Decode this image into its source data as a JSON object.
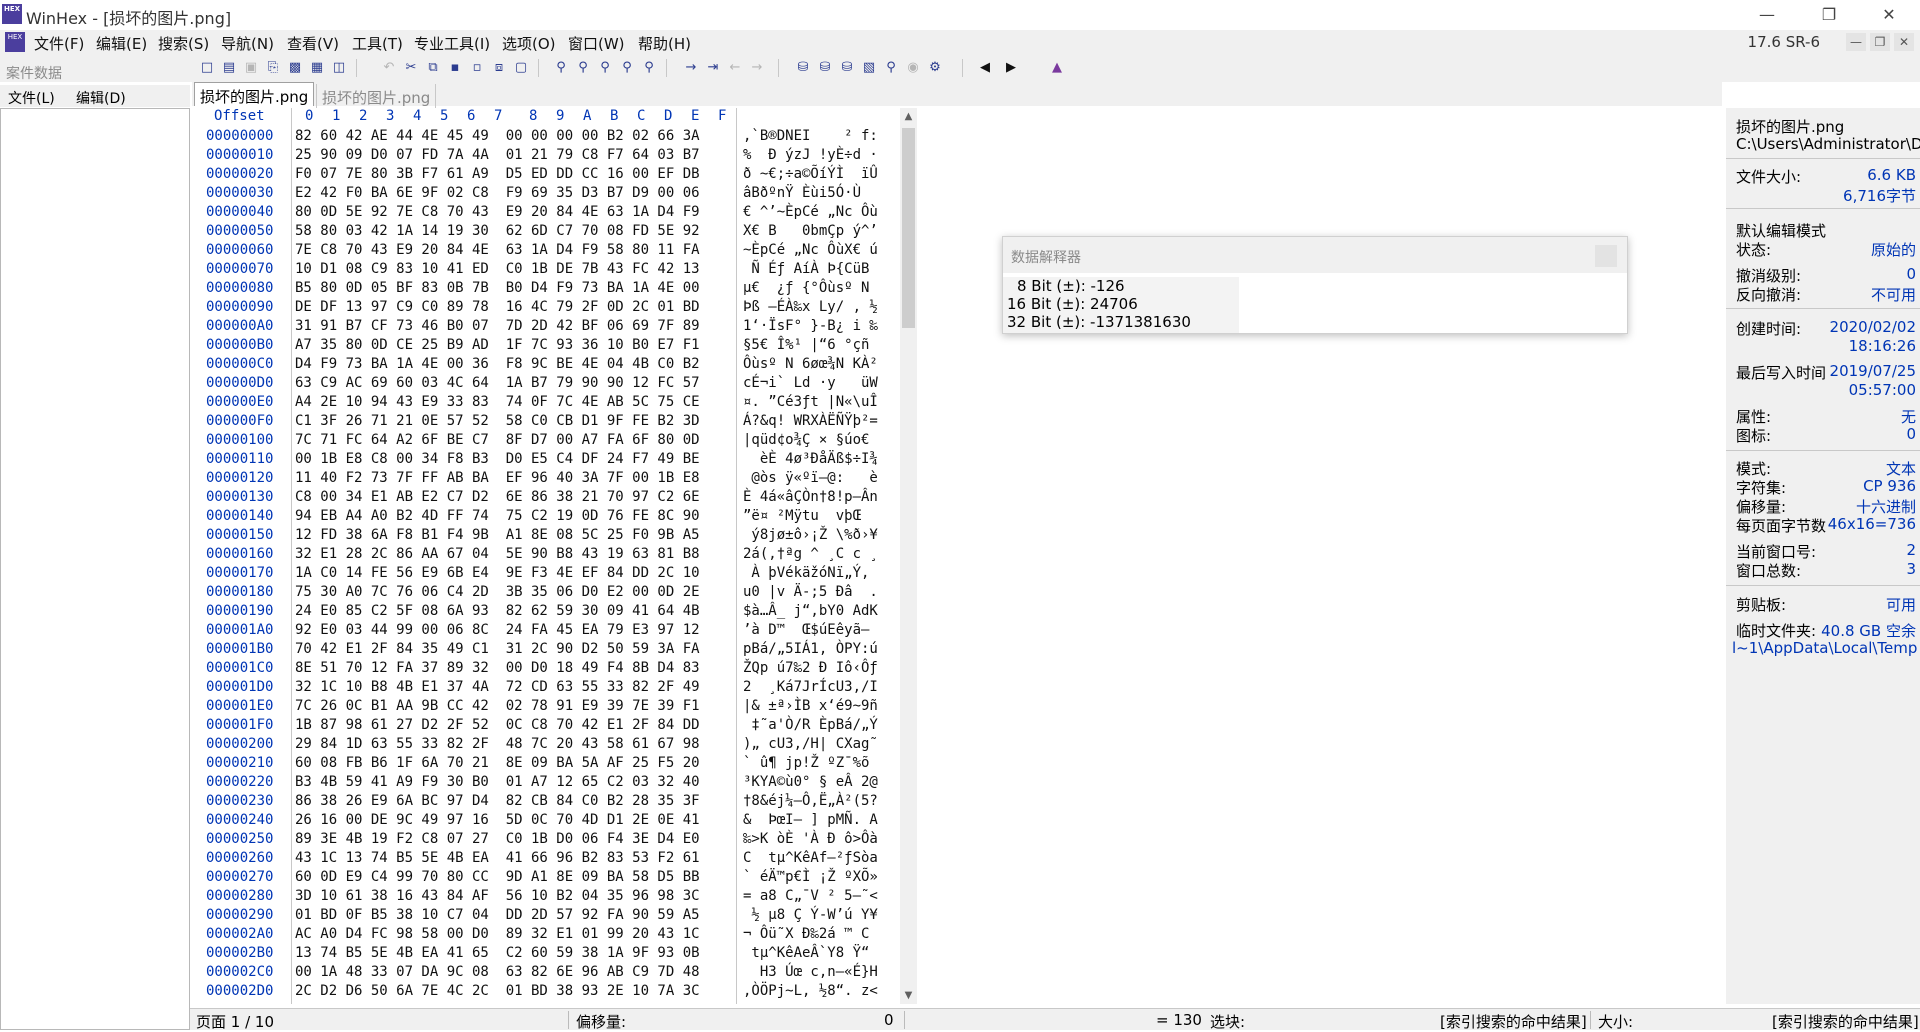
{
  "window": {
    "title": "WinHex - [损坏的图片.png]",
    "logo_text": "HEX"
  },
  "menu": {
    "items": [
      "文件(F)",
      "编辑(E)",
      "搜索(S)",
      "导航(N)",
      "查看(V)",
      "工具(T)",
      "专业工具(I)",
      "选项(O)",
      "窗口(W)",
      "帮助(H)"
    ],
    "version": "17.6 SR-6"
  },
  "left_panel": {
    "title": "案件数据",
    "file_menu": "文件(L)",
    "edit_menu": "编辑(D)"
  },
  "tabs": [
    "损坏的图片.png",
    "损坏的图片.png"
  ],
  "hex_header": {
    "offset": "Offset",
    "columns": [
      "0",
      "1",
      "2",
      "3",
      "4",
      "5",
      "6",
      "7",
      "8",
      "9",
      "A",
      "B",
      "C",
      "D",
      "E",
      "F"
    ]
  },
  "rows": [
    [
      "00000000",
      "82 60 42 AE 44 4E 45 49  00 00 00 00 B2 02 66 3A",
      "‚`B®DNEI    ² f:"
    ],
    [
      "00000010",
      "25 90 09 D0 07 FD 7A 4A  01 21 79 C8 F7 64 03 B7",
      "%  Ð ýzJ !yÈ÷d ·"
    ],
    [
      "00000020",
      "F0 07 7E 80 3B F7 61 A9  D5 ED DD CC 16 00 EF DB",
      "ð ~€;÷a©ÕíÝÌ  ïÛ"
    ],
    [
      "00000030",
      "E2 42 F0 BA 6E 9F 02 C8  F9 69 35 D3 B7 D9 00 06",
      "âBðºnŸ Èùi5Ó·Ù  "
    ],
    [
      "00000040",
      "80 0D 5E 92 7E C8 70 43  E9 20 84 4E 63 1A D4 F9",
      "€ ^’~ÈpCé „Nc Ôù"
    ],
    [
      "00000050",
      "58 80 03 42 1A 14 19 30  62 6D C7 70 08 FD 5E 92",
      "X€ B   0bmÇp ý^’"
    ],
    [
      "00000060",
      "7E C8 70 43 E9 20 84 4E  63 1A D4 F9 58 80 11 FA",
      "~ÈpCé „Nc ÔùX€ ú"
    ],
    [
      "00000070",
      "10 D1 08 C9 83 10 41 ED  C0 1B DE 7B 43 FC 42 13",
      " Ñ Éƒ AíÀ Þ{CüB "
    ],
    [
      "00000080",
      "B5 80 0D 05 BF 83 0B 7B  B0 D4 F9 73 BA 1A 4E 00",
      "µ€  ¿ƒ {°Ôùsº N "
    ],
    [
      "00000090",
      "DE DF 13 97 C9 C0 89 78  16 4C 79 2F 0D 2C 01 BD",
      "Þß —ÉÀ‰x Ly/ , ½"
    ],
    [
      "000000A0",
      "31 91 B7 CF 73 46 B0 07  7D 2D 42 BF 06 69 7F 89",
      "1‘·ÏsF° }-B¿ i ‰"
    ],
    [
      "000000B0",
      "A7 35 80 0D CE 25 B9 AD  1F 7C 93 36 10 B0 E7 F1",
      "§5€ Î%¹­ |“6 °çñ"
    ],
    [
      "000000C0",
      "D4 F9 73 BA 1A 4E 00 36  F8 9C BE 4E 04 4B C0 B2",
      "Ôùsº N 6øœ¾N KÀ²"
    ],
    [
      "000000D0",
      "63 C9 AC 69 60 03 4C 64  1A B7 79 90 90 12 FC 57",
      "cÉ¬i` Ld ·y   üW"
    ],
    [
      "000000E0",
      "A4 2E 10 94 43 E9 33 83  74 0F 7C 4E AB 5C 75 CE",
      "¤. ”Cé3ƒt |N«\\uÎ"
    ],
    [
      "000000F0",
      "C1 3F 26 71 21 0E 57 52  58 C0 CB D1 9F FE B2 3D",
      "Á?&q! WRXÀËÑŸþ²="
    ],
    [
      "00000100",
      "7C 71 FC 64 A2 6F BE C7  8F D7 00 A7 FA 6F 80 0D",
      "|qüd¢o¾Ç × §úo€ "
    ],
    [
      "00000110",
      "00 1B E8 C8 00 34 F8 B3  D0 E5 C4 DF 24 F7 49 BE",
      "  èÈ 4ø³ÐåÄß$÷I¾"
    ],
    [
      "00000120",
      "11 40 F2 73 7F FF AB BA  EF 96 40 3A 7F 00 1B E8",
      " @òs ÿ«ºï–@:   è"
    ],
    [
      "00000130",
      "C8 00 34 E1 AB E2 C7 D2  6E 86 38 21 70 97 C2 6E",
      "È 4á«âÇÒn†8!p—Ân"
    ],
    [
      "00000140",
      "94 EB A4 A0 B2 4D FF 74  75 C2 19 0D 76 FE 8C 90",
      "”ë¤ ²Mÿtu  vþŒ "
    ],
    [
      "00000150",
      "12 FD 38 6A F8 B1 F4 9B  A1 8E 08 5C 25 F0 9B A5",
      " ý8jø±ô›¡Ž \\%ð›¥"
    ],
    [
      "00000160",
      "32 E1 28 2C 86 AA 67 04  5E 90 B8 43 19 63 81 B8",
      "2á(,†ªg ^ ¸C c ¸"
    ],
    [
      "00000170",
      "1A C0 14 FE 56 E9 6B E4  9E F3 4E EF 84 DD 2C 10",
      " À þVékäžóNï„Ý, "
    ],
    [
      "00000180",
      "75 30 A0 7C 76 06 C4 2D  3B 35 06 D0 E2 00 0D 2E",
      "u0 |v Ä-;5 Ðâ  ."
    ],
    [
      "00000190",
      "24 E0 85 C2 5F 08 6A 93  82 62 59 30 09 41 64 4B",
      "$à…Â_ j“‚bY0 AdK"
    ],
    [
      "000001A0",
      "92 E0 03 44 99 00 06 8C  24 FA 45 EA 79 E3 97 12",
      "’à D™  Œ$úEêyã— "
    ],
    [
      "000001B0",
      "70 42 E1 2F 84 35 49 C1  31 2C 90 D2 50 59 3A FA",
      "pBá/„5IÁ1, ÒPY:ú"
    ],
    [
      "000001C0",
      "8E 51 70 12 FA 37 89 32  00 D0 18 49 F4 8B D4 83",
      "ŽQp ú7‰2 Ð Iô‹Ôƒ"
    ],
    [
      "000001D0",
      "32 1C 10 B8 4B E1 37 4A  72 CD 63 55 33 82 2F 49",
      "2  ¸Ká7JrÍcU3‚/I"
    ],
    [
      "000001E0",
      "7C 26 0C B1 AA 9B CC 42  02 78 91 E9 39 7E 39 F1",
      "|& ±ª›ÌB x‘é9~9ñ"
    ],
    [
      "000001F0",
      "1B 87 98 61 27 D2 2F 52  0C C8 70 42 E1 2F 84 DD",
      " ‡˜a'Ò/R ÈpBá/„Ý"
    ],
    [
      "00000200",
      "29 84 1D 63 55 33 82 2F  48 7C 20 43 58 61 67 98",
      ")„ cU3‚/H| CXag˜"
    ],
    [
      "00000210",
      "60 08 FB B6 1F 6A 70 21  8E 09 BA 5A AF 25 F5 20",
      "` û¶ jp!Ž ºZ¯%õ "
    ],
    [
      "00000220",
      "B3 4B 59 41 A9 F9 30 B0  01 A7 12 65 C2 03 32 40",
      "³KYA©ù0° § eÂ 2@"
    ],
    [
      "00000230",
      "86 38 26 E9 6A BC 97 D4  82 CB 84 C0 B2 28 35 3F",
      "†8&éj¼—Ô‚Ë„À²(5?"
    ],
    [
      "00000240",
      "26 16 00 DE 9C 49 97 16  5D 0C 70 4D D1 2E 0E 41",
      "&  ÞœI— ] pMÑ. A"
    ],
    [
      "00000250",
      "89 3E 4B 19 F2 C8 07 27  C0 1B D0 06 F4 3E D4 E0",
      "‰>K òÈ 'À Ð ô>Ôà"
    ],
    [
      "00000260",
      "43 1C 13 74 B5 5E 4B EA  41 66 96 B2 83 53 F2 61",
      "C  tµ^KêAf–²ƒSòa"
    ],
    [
      "00000270",
      "60 0D E9 C4 99 70 80 CC  9D A1 8E 09 BA 58 D5 BB",
      "` éÄ™p€Ì ¡Ž ºXÕ»"
    ],
    [
      "00000280",
      "3D 10 61 38 16 43 84 AF  56 10 B2 04 35 96 98 3C",
      "= a8 C„¯V ² 5–˜<"
    ],
    [
      "00000290",
      "01 BD 0F B5 38 10 C7 04  DD 2D 57 92 FA 90 59 A5",
      " ½ µ8 Ç Ý-W’ú Y¥"
    ],
    [
      "000002A0",
      "AC A0 D4 FC 98 58 00 D0  89 32 E1 01 99 20 43 1C",
      "¬ Ôü˜X Ð‰2á ™ C "
    ],
    [
      "000002B0",
      "13 74 B5 5E 4B EA 41 65  C2 60 59 38 1A 9F 93 0B",
      " tµ^KêAeÂ`Y8 Ÿ“ "
    ],
    [
      "000002C0",
      "00 1A 48 33 07 DA 9C 08  63 82 6E 96 AB C9 7D 48",
      "  H3 Úœ c‚n–«É}H"
    ],
    [
      "000002D0",
      "2C D2 D6 50 6A 7E 4C 2C  01 BD 38 93 2E 10 7A 3C",
      ",ÒÖPj~L, ½8“. z<"
    ]
  ],
  "interpreter": {
    "title": "数据解释器",
    "lines": [
      "8 Bit (±): -126",
      "16 Bit (±): 24706",
      "32 Bit (±): -1371381630"
    ]
  },
  "right_panel": {
    "filename": "损坏的图片.png",
    "path": "C:\\Users\\Administrator\\D",
    "file_size_label": "文件大小:",
    "file_size": "6.6 KB",
    "file_bytes": "6,716字节",
    "default_mode": "默认编辑模式",
    "state_label": "状态:",
    "state": "原始的",
    "undo_level_label": "撤消级别:",
    "undo_level": "0",
    "undo_reverse_label": "反向撤消:",
    "undo_reverse": "不可用",
    "created_label": "创建时间:",
    "created_date": "2020/02/02",
    "created_time": "18:16:26",
    "modified_label": "最后写入时间",
    "modified_date": "2019/07/25",
    "modified_time": "05:57:00",
    "attr_label": "属性:",
    "attr": "无",
    "icon_label": "图标:",
    "icon": "0",
    "mode_label": "模式:",
    "mode": "文本",
    "charset_label": "字符集:",
    "charset": "CP 936",
    "offset_label": "偏移量:",
    "offset": "十六进制",
    "bytes_per_page_label": "每页面字节数",
    "bytes_per_page": "46x16=736",
    "cur_window_label": "当前窗口号:",
    "cur_window": "2",
    "total_windows_label": "窗口总数:",
    "total_windows": "3",
    "clipboard_label": "剪贴板:",
    "clipboard": "可用",
    "temp_label": "临时文件夹:",
    "temp": "40.8 GB 空余",
    "temp_path": "l~1\\AppData\\Local\\Temp"
  },
  "status": {
    "page": "页面 1 / 10",
    "offset_label": "偏移量:",
    "offset_value": "0",
    "value": "= 130",
    "selection_label": "选块:",
    "search_hits": "[索引搜索的命中结果]",
    "size_label": "大小:",
    "search_hits2": "[索引搜索的命中结果]"
  }
}
